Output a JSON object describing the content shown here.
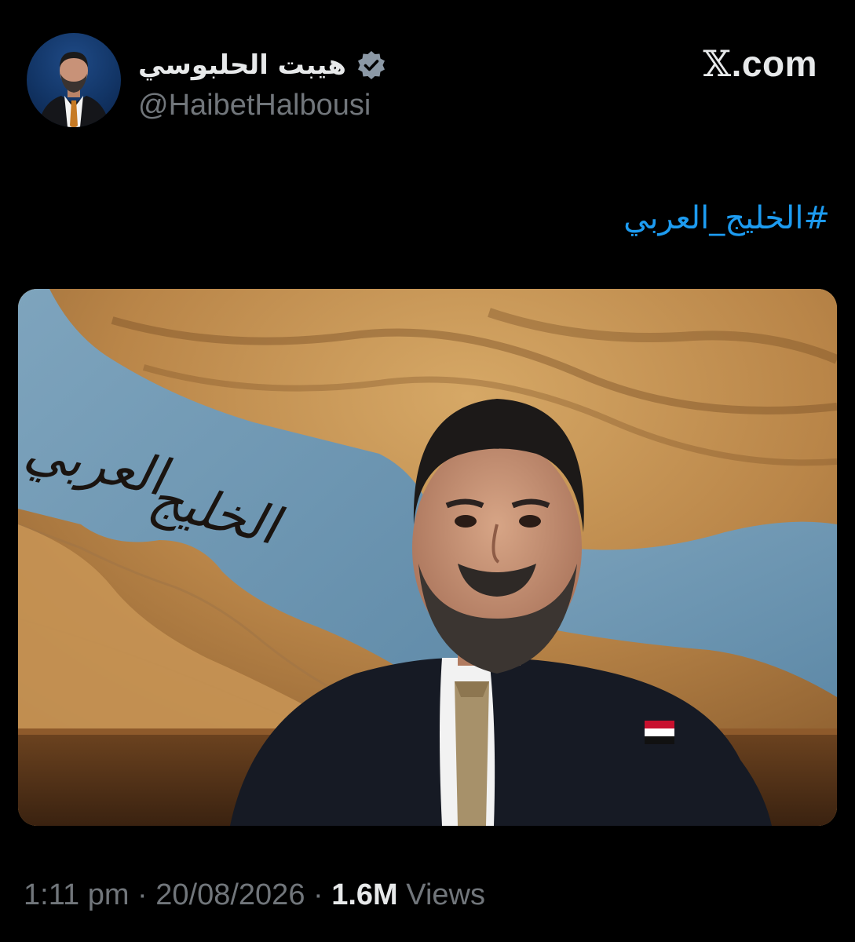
{
  "author": {
    "display_name": "هيبت الحلبوسي",
    "handle": "@HaibetHalbousi",
    "verified_icon": "verified-badge-icon",
    "verified_color": "#8b98a5"
  },
  "site": {
    "logo_glyph": "𝕏",
    "logo_text": ".com"
  },
  "post": {
    "hashtag": "#الخليج_العربي",
    "hashtag_color": "#1d9bf0",
    "image": {
      "calligraphy_line1": "العربي",
      "calligraphy_line2": "الخليج"
    },
    "time": "1:11 pm",
    "separator": "·",
    "date": "20/08/2026",
    "views_count": "1.6M",
    "views_label": "Views"
  },
  "colors": {
    "background": "#000000",
    "text_primary": "#e7e9ea",
    "text_secondary": "#71767b"
  }
}
